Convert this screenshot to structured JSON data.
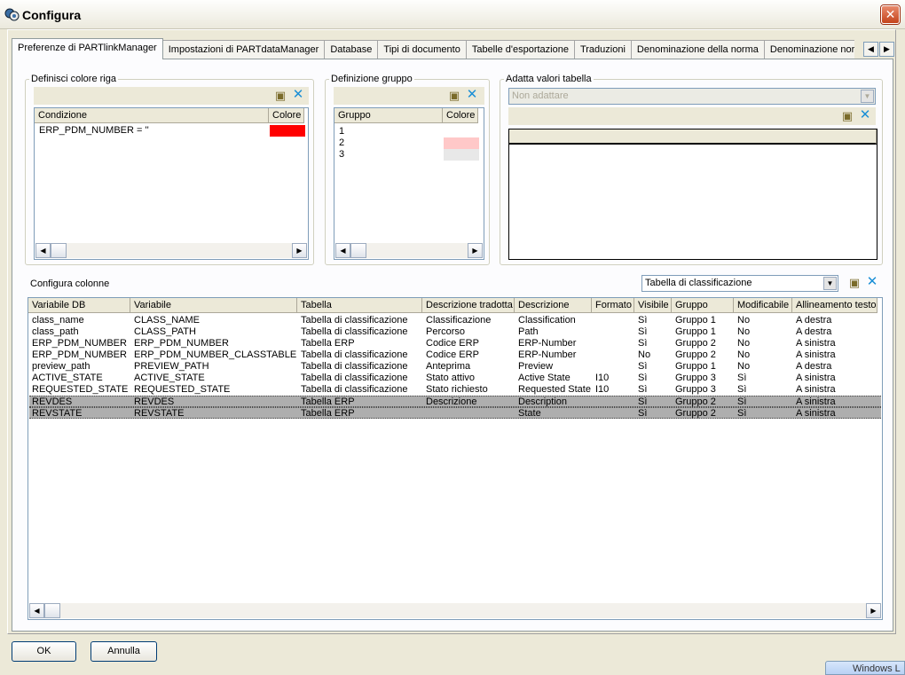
{
  "window": {
    "title": "Configura",
    "close_glyph": "✕"
  },
  "tabs": [
    "Preferenze di PARTlinkManager",
    "Impostazioni di PARTdataManager",
    "Database",
    "Tipi di documento",
    "Tabelle d'esportazione",
    "Traduzioni",
    "Denominazione della norma",
    "Denominazione norm"
  ],
  "tab_scroll": {
    "left": "◀",
    "right": "▶"
  },
  "row_color": {
    "legend": "Definisci colore riga",
    "columns": [
      "Condizione",
      "Colore"
    ],
    "rows": [
      {
        "condition": "ERP_PDM_NUMBER = ''",
        "color": "#ff0000"
      }
    ]
  },
  "group_def": {
    "legend": "Definizione gruppo",
    "columns": [
      "Gruppo",
      "Colore"
    ],
    "rows": [
      {
        "group": "1",
        "color": "#ffffff"
      },
      {
        "group": "2",
        "color": "#ffc8c8"
      },
      {
        "group": "3",
        "color": "#e8e8e8"
      }
    ]
  },
  "adapt_values": {
    "legend": "Adatta valori tabella",
    "combo_value": "Non adattare"
  },
  "columns_config": {
    "label": "Configura colonne",
    "combo_value": "Tabella di classificazione",
    "headers": [
      "Variabile DB",
      "Variabile",
      "Tabella",
      "Descrizione tradotta",
      "Descrizione",
      "Formato",
      "Visibile",
      "Gruppo",
      "Modificabile",
      "Allineamento testo"
    ],
    "rows": [
      [
        "class_name",
        "CLASS_NAME",
        "Tabella di classificazione",
        "Classificazione",
        "Classification",
        "",
        "Sì",
        "Gruppo 1",
        "No",
        "A destra"
      ],
      [
        "class_path",
        "CLASS_PATH",
        "Tabella di classificazione",
        "Percorso",
        "Path",
        "",
        "Sì",
        "Gruppo 1",
        "No",
        "A destra"
      ],
      [
        "ERP_PDM_NUMBER",
        "ERP_PDM_NUMBER",
        "Tabella ERP",
        "Codice ERP",
        "ERP-Number",
        "",
        "Sì",
        "Gruppo 2",
        "No",
        "A sinistra"
      ],
      [
        "ERP_PDM_NUMBER",
        "ERP_PDM_NUMBER_CLASSTABLE",
        "Tabella di classificazione",
        "Codice ERP",
        "ERP-Number",
        "",
        "No",
        "Gruppo 2",
        "No",
        "A sinistra"
      ],
      [
        "preview_path",
        "PREVIEW_PATH",
        "Tabella di classificazione",
        "Anteprima",
        "Preview",
        "",
        "Sì",
        "Gruppo 1",
        "No",
        "A destra"
      ],
      [
        "ACTIVE_STATE",
        "ACTIVE_STATE",
        "Tabella di classificazione",
        "Stato attivo",
        "Active State",
        "I10",
        "Sì",
        "Gruppo 3",
        "Sì",
        "A sinistra"
      ],
      [
        "REQUESTED_STATE",
        "REQUESTED_STATE",
        "Tabella di classificazione",
        "Stato richiesto",
        "Requested State",
        "I10",
        "Sì",
        "Gruppo 3",
        "Sì",
        "A sinistra"
      ],
      [
        "REVDES",
        "REVDES",
        "Tabella ERP",
        "Descrizione",
        "Description",
        "",
        "Sì",
        "Gruppo 2",
        "Sì",
        "A sinistra"
      ],
      [
        "REVSTATE",
        "REVSTATE",
        "Tabella ERP",
        "",
        "State",
        "",
        "Sì",
        "Gruppo 2",
        "Sì",
        "A sinistra"
      ]
    ],
    "selected_rows": [
      7,
      8
    ]
  },
  "buttons": {
    "ok": "OK",
    "cancel": "Annulla"
  },
  "taskbar": {
    "label": "Windows L"
  }
}
